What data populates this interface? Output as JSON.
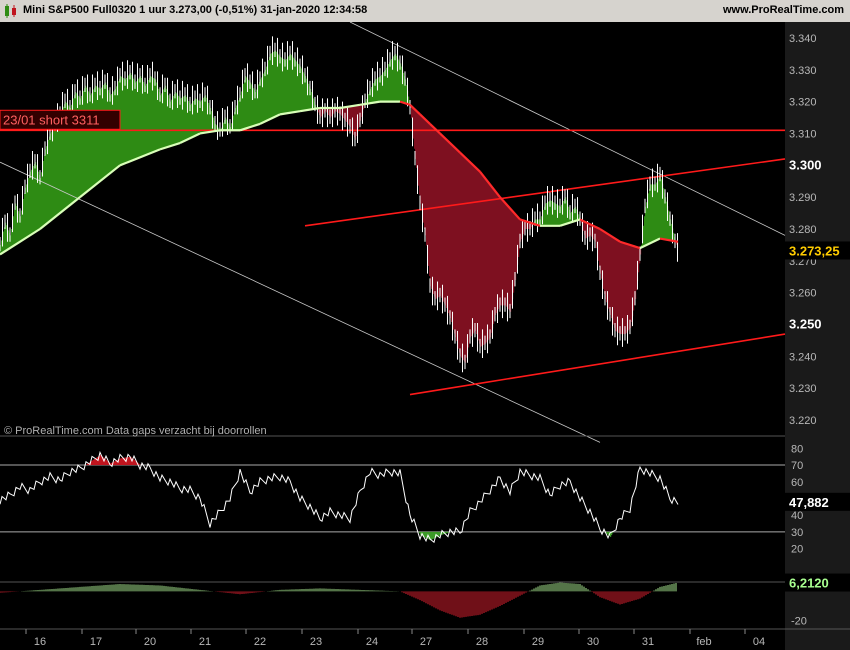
{
  "header": {
    "title": "Mini S&P500 Full0320 1 uur 3.273,00 (-0,51%) 31-jan-2020 12:34:58",
    "site": "www.ProRealTime.com"
  },
  "watermark": "© ProRealTime.com  Data gaps verzacht bij doorrollen",
  "annotation": "23/01 short 3311",
  "colors": {
    "background": "#000000",
    "price": "#ffffff",
    "above_ma": "#2e8b14",
    "below_ma": "#7e1020",
    "ma_up": "#d9ffb8",
    "ma_down": "#ff2a2a",
    "trendline": "#ff1a1a",
    "channel": "#c8c8c8",
    "axis_panel": "#1a1a1a"
  },
  "chart_data": [
    {
      "type": "line",
      "subtype": "hourly price with moving average cloud",
      "x": [
        "16",
        "17",
        "20",
        "21",
        "22",
        "23",
        "24",
        "27",
        "28",
        "29",
        "30",
        "31",
        "feb",
        "04"
      ],
      "ylim": [
        3215,
        3345
      ],
      "yticks": [
        "3.340",
        "3.330",
        "3.320",
        "3.310",
        "3.300",
        "3.290",
        "3.280",
        "3.270",
        "3.260",
        "3.250",
        "3.240",
        "3.230",
        "3.220"
      ],
      "bold_ticks": [
        "3.300",
        "3.250"
      ],
      "last_price_label": "3.273,25",
      "price_series": [
        [
          0,
          3275
        ],
        [
          5,
          3282
        ],
        [
          10,
          3278
        ],
        [
          15,
          3288
        ],
        [
          20,
          3284
        ],
        [
          25,
          3293
        ],
        [
          30,
          3298
        ],
        [
          35,
          3301
        ],
        [
          40,
          3296
        ],
        [
          45,
          3305
        ],
        [
          50,
          3310
        ],
        [
          55,
          3313
        ],
        [
          60,
          3316
        ],
        [
          65,
          3320
        ],
        [
          70,
          3318
        ],
        [
          75,
          3323
        ],
        [
          80,
          3321
        ],
        [
          85,
          3325
        ],
        [
          90,
          3322
        ],
        [
          95,
          3325
        ],
        [
          100,
          3324
        ],
        [
          105,
          3326
        ],
        [
          110,
          3322
        ],
        [
          115,
          3324
        ],
        [
          120,
          3328
        ],
        [
          125,
          3327
        ],
        [
          130,
          3329
        ],
        [
          135,
          3326
        ],
        [
          140,
          3328
        ],
        [
          145,
          3325
        ],
        [
          150,
          3328
        ],
        [
          155,
          3327
        ],
        [
          160,
          3322
        ],
        [
          165,
          3325
        ],
        [
          170,
          3320
        ],
        [
          175,
          3323
        ],
        [
          180,
          3321
        ],
        [
          185,
          3322
        ],
        [
          190,
          3319
        ],
        [
          195,
          3321
        ],
        [
          200,
          3320
        ],
        [
          205,
          3322
        ],
        [
          210,
          3318
        ],
        [
          215,
          3313
        ],
        [
          220,
          3311
        ],
        [
          225,
          3315
        ],
        [
          230,
          3312
        ],
        [
          235,
          3318
        ],
        [
          240,
          3322
        ],
        [
          245,
          3328
        ],
        [
          250,
          3326
        ],
        [
          255,
          3323
        ],
        [
          260,
          3327
        ],
        [
          265,
          3330
        ],
        [
          270,
          3335
        ],
        [
          275,
          3336
        ],
        [
          280,
          3334
        ],
        [
          285,
          3333
        ],
        [
          290,
          3335
        ],
        [
          295,
          3333
        ],
        [
          300,
          3331
        ],
        [
          305,
          3328
        ],
        [
          310,
          3324
        ],
        [
          315,
          3319
        ],
        [
          320,
          3315
        ],
        [
          325,
          3317
        ],
        [
          330,
          3315
        ],
        [
          335,
          3317
        ],
        [
          340,
          3316
        ],
        [
          345,
          3314
        ],
        [
          350,
          3312
        ],
        [
          355,
          3308
        ],
        [
          360,
          3314
        ],
        [
          365,
          3320
        ],
        [
          370,
          3324
        ],
        [
          375,
          3327
        ],
        [
          380,
          3328
        ],
        [
          385,
          3330
        ],
        [
          390,
          3333
        ],
        [
          395,
          3335
        ],
        [
          400,
          3332
        ],
        [
          405,
          3327
        ],
        [
          410,
          3318
        ],
        [
          415,
          3302
        ],
        [
          420,
          3288
        ],
        [
          425,
          3278
        ],
        [
          430,
          3262
        ],
        [
          435,
          3258
        ],
        [
          440,
          3259
        ],
        [
          445,
          3256
        ],
        [
          450,
          3252
        ],
        [
          455,
          3246
        ],
        [
          460,
          3240
        ],
        [
          465,
          3238
        ],
        [
          470,
          3246
        ],
        [
          475,
          3248
        ],
        [
          480,
          3243
        ],
        [
          485,
          3244
        ],
        [
          490,
          3246
        ],
        [
          495,
          3253
        ],
        [
          500,
          3256
        ],
        [
          505,
          3256
        ],
        [
          510,
          3254
        ],
        [
          515,
          3264
        ],
        [
          520,
          3276
        ],
        [
          525,
          3280
        ],
        [
          530,
          3280
        ],
        [
          535,
          3283
        ],
        [
          540,
          3283
        ],
        [
          545,
          3288
        ],
        [
          550,
          3289
        ],
        [
          555,
          3288
        ],
        [
          560,
          3287
        ],
        [
          565,
          3290
        ],
        [
          570,
          3285
        ],
        [
          575,
          3287
        ],
        [
          580,
          3283
        ],
        [
          585,
          3277
        ],
        [
          590,
          3278
        ],
        [
          595,
          3276
        ],
        [
          600,
          3266
        ],
        [
          605,
          3258
        ],
        [
          610,
          3253
        ],
        [
          615,
          3248
        ],
        [
          620,
          3247
        ],
        [
          625,
          3247
        ],
        [
          630,
          3249
        ],
        [
          635,
          3258
        ],
        [
          640,
          3272
        ],
        [
          645,
          3287
        ],
        [
          650,
          3294
        ],
        [
          655,
          3294
        ],
        [
          660,
          3297
        ],
        [
          665,
          3290
        ],
        [
          670,
          3283
        ],
        [
          675,
          3276
        ],
        [
          678,
          3273.25
        ]
      ],
      "ma_series": [
        [
          0,
          3272
        ],
        [
          40,
          3280
        ],
        [
          80,
          3290
        ],
        [
          120,
          3300
        ],
        [
          160,
          3305
        ],
        [
          180,
          3307
        ],
        [
          200,
          3310
        ],
        [
          220,
          3311
        ],
        [
          240,
          3311
        ],
        [
          260,
          3313
        ],
        [
          280,
          3316
        ],
        [
          300,
          3317
        ],
        [
          320,
          3318
        ],
        [
          340,
          3318
        ],
        [
          360,
          3319
        ],
        [
          380,
          3320
        ],
        [
          400,
          3320
        ],
        [
          410,
          3319
        ],
        [
          420,
          3316
        ],
        [
          430,
          3313
        ],
        [
          440,
          3310
        ],
        [
          460,
          3304
        ],
        [
          480,
          3298
        ],
        [
          500,
          3290
        ],
        [
          520,
          3283
        ],
        [
          540,
          3281
        ],
        [
          560,
          3281
        ],
        [
          580,
          3283
        ],
        [
          600,
          3280
        ],
        [
          620,
          3276
        ],
        [
          640,
          3274
        ],
        [
          660,
          3277
        ],
        [
          678,
          3276
        ]
      ],
      "trendlines": [
        {
          "name": "resistance",
          "points": [
            [
              305,
              3281
            ],
            [
              785,
              3302
            ]
          ]
        },
        {
          "name": "support",
          "points": [
            [
              410,
              3228
            ],
            [
              785,
              3247
            ]
          ]
        },
        {
          "name": "short level",
          "points": [
            [
              0,
              3311
            ],
            [
              785,
              3311
            ]
          ]
        }
      ],
      "channel_lines": [
        {
          "points": [
            [
              350,
              3345
            ],
            [
              785,
              3278
            ]
          ]
        },
        {
          "points": [
            [
              0,
              3301
            ],
            [
              600,
              3213
            ]
          ]
        }
      ]
    },
    {
      "type": "line",
      "subtype": "oscillator",
      "ylim": [
        0,
        85
      ],
      "yticks": [
        "80",
        "70",
        "60",
        "50",
        "40",
        "30",
        "20"
      ],
      "levels": [
        70,
        30
      ],
      "last_value_label": "47,882",
      "values": [
        [
          0,
          49
        ],
        [
          10,
          52
        ],
        [
          20,
          57
        ],
        [
          30,
          55
        ],
        [
          40,
          60
        ],
        [
          50,
          63
        ],
        [
          60,
          61
        ],
        [
          70,
          66
        ],
        [
          80,
          68
        ],
        [
          90,
          72
        ],
        [
          100,
          76
        ],
        [
          110,
          71
        ],
        [
          120,
          74
        ],
        [
          130,
          75
        ],
        [
          140,
          70
        ],
        [
          150,
          68
        ],
        [
          160,
          62
        ],
        [
          170,
          60
        ],
        [
          180,
          56
        ],
        [
          190,
          55
        ],
        [
          200,
          50
        ],
        [
          210,
          35
        ],
        [
          220,
          42
        ],
        [
          230,
          50
        ],
        [
          240,
          66
        ],
        [
          250,
          54
        ],
        [
          260,
          60
        ],
        [
          270,
          62
        ],
        [
          280,
          63
        ],
        [
          290,
          60
        ],
        [
          300,
          50
        ],
        [
          310,
          45
        ],
        [
          320,
          38
        ],
        [
          330,
          42
        ],
        [
          340,
          40
        ],
        [
          350,
          38
        ],
        [
          360,
          54
        ],
        [
          370,
          66
        ],
        [
          380,
          64
        ],
        [
          390,
          66
        ],
        [
          400,
          65
        ],
        [
          410,
          40
        ],
        [
          420,
          28
        ],
        [
          430,
          25
        ],
        [
          440,
          28
        ],
        [
          450,
          30
        ],
        [
          460,
          30
        ],
        [
          470,
          42
        ],
        [
          480,
          48
        ],
        [
          490,
          55
        ],
        [
          500,
          62
        ],
        [
          510,
          54
        ],
        [
          520,
          66
        ],
        [
          530,
          64
        ],
        [
          540,
          62
        ],
        [
          550,
          52
        ],
        [
          560,
          58
        ],
        [
          570,
          60
        ],
        [
          580,
          50
        ],
        [
          590,
          42
        ],
        [
          600,
          32
        ],
        [
          610,
          27
        ],
        [
          620,
          38
        ],
        [
          630,
          44
        ],
        [
          640,
          68
        ],
        [
          650,
          65
        ],
        [
          660,
          62
        ],
        [
          670,
          50
        ],
        [
          678,
          48
        ]
      ]
    },
    {
      "type": "bar",
      "subtype": "momentum histogram",
      "ylim": [
        -25,
        5
      ],
      "yticks": [
        "-20"
      ],
      "last_value_label": "6,2120",
      "values": [
        [
          0,
          -1
        ],
        [
          40,
          1
        ],
        [
          80,
          3
        ],
        [
          120,
          5
        ],
        [
          160,
          4
        ],
        [
          200,
          1
        ],
        [
          240,
          -2
        ],
        [
          280,
          1
        ],
        [
          320,
          2
        ],
        [
          360,
          1
        ],
        [
          400,
          0
        ],
        [
          420,
          -6
        ],
        [
          440,
          -13
        ],
        [
          460,
          -18
        ],
        [
          480,
          -16
        ],
        [
          500,
          -10
        ],
        [
          520,
          -3
        ],
        [
          540,
          4
        ],
        [
          560,
          6
        ],
        [
          580,
          5
        ],
        [
          600,
          -4
        ],
        [
          620,
          -9
        ],
        [
          640,
          -5
        ],
        [
          660,
          3
        ],
        [
          678,
          6
        ]
      ]
    }
  ]
}
